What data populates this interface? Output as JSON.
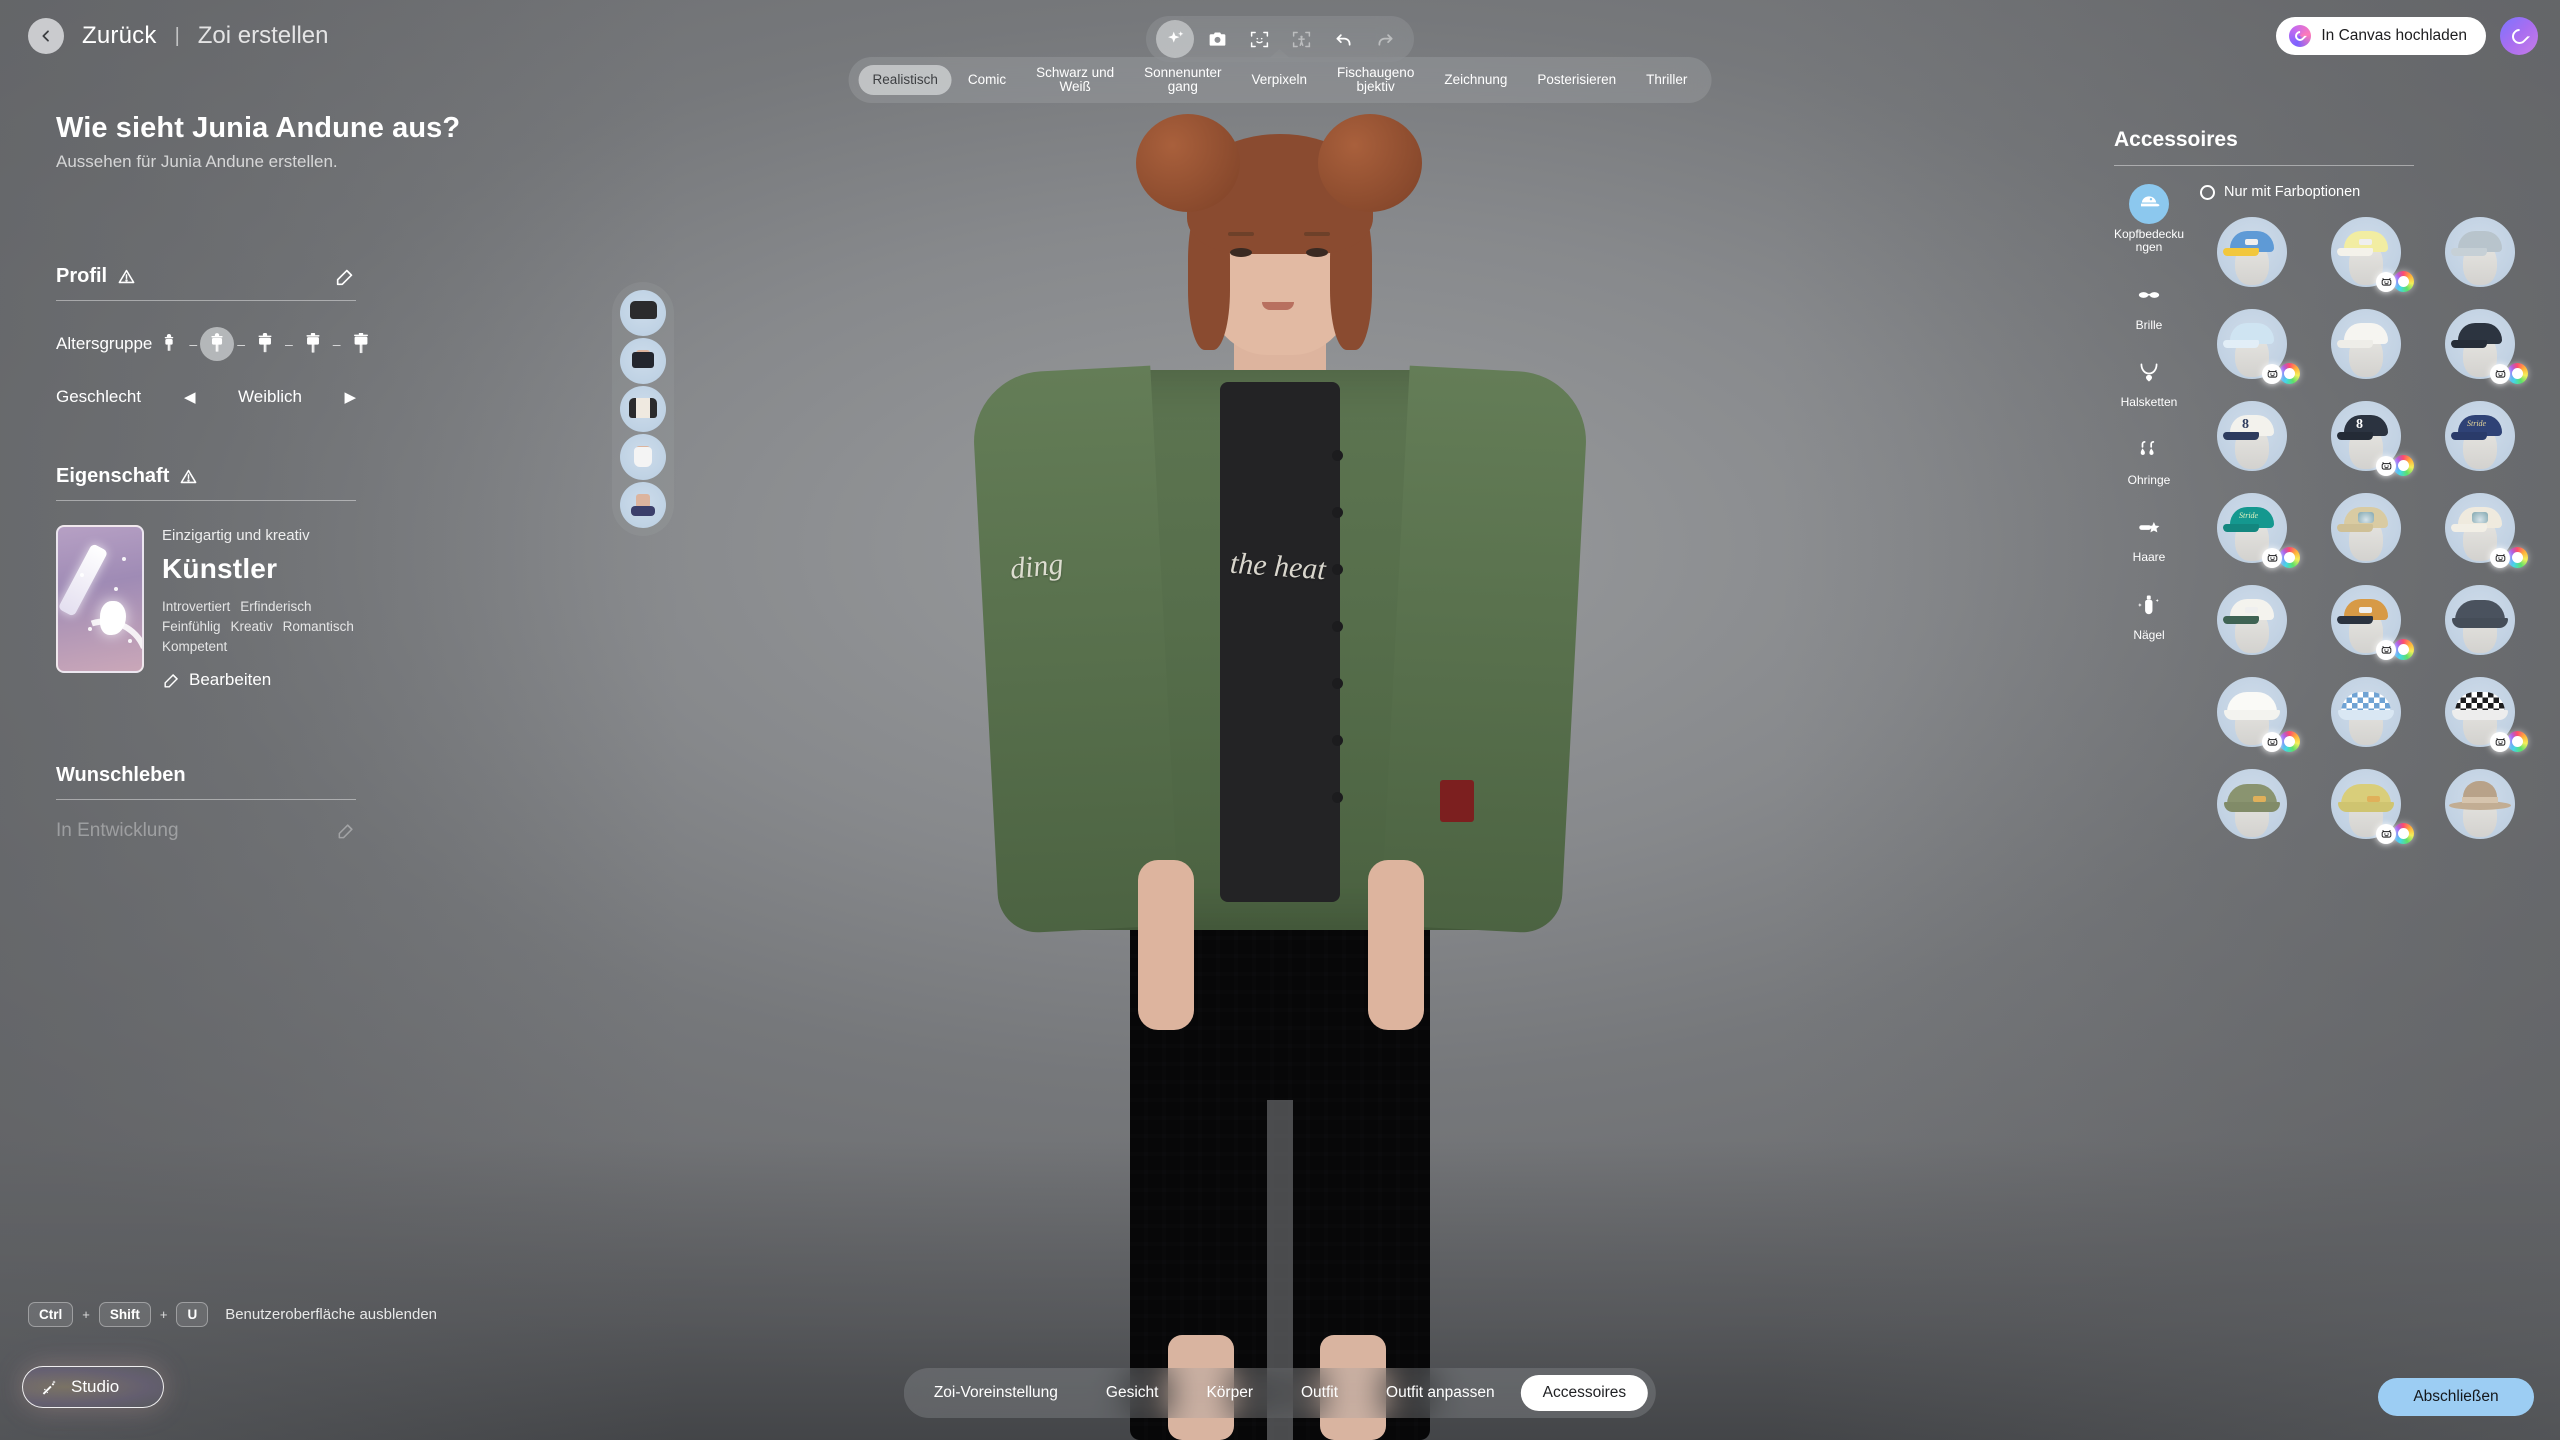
{
  "header": {
    "back_label": "Zurück",
    "separator": "|",
    "current_label": "Zoi erstellen",
    "title": "Wie sieht Junia Andune aus?",
    "subtitle": "Aussehen für Junia Andune erstellen."
  },
  "top_right": {
    "canvas_button": "In Canvas hochladen"
  },
  "toolbar": {
    "items": [
      {
        "name": "sparkle-icon",
        "selected": true,
        "dimmed": false
      },
      {
        "name": "camera-icon",
        "selected": false,
        "dimmed": false
      },
      {
        "name": "face-frame-icon",
        "selected": false,
        "dimmed": false
      },
      {
        "name": "body-frame-icon",
        "selected": false,
        "dimmed": true
      },
      {
        "name": "undo-icon",
        "selected": false,
        "dimmed": false
      },
      {
        "name": "redo-icon",
        "selected": false,
        "dimmed": true
      }
    ]
  },
  "style_tabs": {
    "selected": "Realistisch",
    "items": [
      "Realistisch",
      "Comic",
      "Schwarz und\nWeiß",
      "Sonnenunter\ngang",
      "Verpixeln",
      "Fischaugeno\nbjektiv",
      "Zeichnung",
      "Posterisieren",
      "Thriller"
    ]
  },
  "left_panel": {
    "profile": {
      "title": "Profil",
      "warning_icon": "warning-triangle-icon",
      "edit_icon": "edit-pencil-icon",
      "age_row_label": "Altersgruppe",
      "age_options": [
        "child",
        "teen",
        "young-adult",
        "adult",
        "senior"
      ],
      "age_selected_index": 1,
      "gender_row_label": "Geschlecht",
      "gender_value": "Weiblich",
      "gender_prev_icon": "chevron-left-icon",
      "gender_next_icon": "chevron-right-icon"
    },
    "trait": {
      "title": "Eigenschaft",
      "warning_icon": "warning-triangle-icon",
      "subtitle": "Einzigartig und kreativ",
      "name": "Künstler",
      "tags": [
        "Introvertiert",
        "Erfinderisch",
        "Feinfühlig",
        "Kreativ",
        "Romantisch",
        "Kompetent"
      ],
      "edit_label": "Bearbeiten",
      "card_art": "paintbrush-tarot-card"
    },
    "dream_life": {
      "title": "Wunschleben",
      "placeholder": "In Entwicklung",
      "edit_icon": "edit-pencil-icon"
    }
  },
  "shortcut": {
    "keys": [
      "Ctrl",
      "Shift",
      "U"
    ],
    "plus": "+",
    "label": "Benutzeroberfläche ausblenden"
  },
  "studio_button": {
    "label": "Studio",
    "icon": "magic-wand-icon"
  },
  "outfit_strip": {
    "items": [
      "shirt",
      "shorts",
      "jacket",
      "socks",
      "shoes"
    ]
  },
  "right_panel": {
    "title": "Accessoires",
    "filter": {
      "label": "Nur mit Farboptionen",
      "checked": false
    },
    "categories": [
      {
        "label": "Kopfbedecku\nngen",
        "icon": "cap-icon",
        "selected": true
      },
      {
        "label": "Brille",
        "icon": "glasses-icon",
        "selected": false
      },
      {
        "label": "Halsketten",
        "icon": "necklace-icon",
        "selected": false
      },
      {
        "label": "Ohringe",
        "icon": "earrings-icon",
        "selected": false
      },
      {
        "label": "Haare",
        "icon": "hairclip-icon",
        "selected": false
      },
      {
        "label": "Nägel",
        "icon": "nail-polish-icon",
        "selected": false
      }
    ],
    "items": [
      {
        "type": "cap",
        "crown": "#5e9ad6",
        "brim": "#f2c73c",
        "patch": true,
        "badges": false
      },
      {
        "type": "cap",
        "crown": "#f2eda2",
        "brim": "#f4f2ea",
        "patch": true,
        "badges": true
      },
      {
        "type": "cap",
        "crown": "#b8c4cc",
        "brim": "#c6d0d6",
        "patch": false,
        "badges": false
      },
      {
        "type": "cap",
        "crown": "#cfe4f2",
        "brim": "#e2eef7",
        "patch": false,
        "badges": true
      },
      {
        "type": "cap",
        "crown": "#f6f5f1",
        "brim": "#eeede8",
        "patch": false,
        "badges": false
      },
      {
        "type": "cap",
        "crown": "#2c3440",
        "brim": "#262d38",
        "patch": false,
        "badges": true
      },
      {
        "type": "cap",
        "crown": "#f3f2ed",
        "brim": "#2d3b5e",
        "num": "8",
        "numcolor": "#2d3b5e",
        "badges": false
      },
      {
        "type": "cap",
        "crown": "#2b3340",
        "brim": "#242b36",
        "num": "8",
        "numcolor": "#ffffff",
        "badges": true
      },
      {
        "type": "cap",
        "crown": "#2f4276",
        "brim": "#2a3b6a",
        "script": "Stride",
        "scriptcolor": "#e8d79a",
        "badges": false
      },
      {
        "type": "cap",
        "crown": "#14988f",
        "brim": "#13877f",
        "script": "Stride",
        "scriptcolor": "#dff3c0",
        "badges": true
      },
      {
        "type": "cap",
        "crown": "#d9cba2",
        "brim": "#cfc096",
        "mtn": true,
        "badges": false
      },
      {
        "type": "cap",
        "crown": "#efeade",
        "brim": "#f2efe6",
        "mtn": true,
        "badges": true
      },
      {
        "type": "cap",
        "crown": "#f4f3ee",
        "brim": "#3f6354",
        "patch": true,
        "badges": false
      },
      {
        "type": "cap",
        "crown": "#d79a46",
        "brim": "#2b3340",
        "patch": true,
        "badges": true
      },
      {
        "type": "bucket",
        "crown": "#4a525e",
        "brim": "#454d58",
        "badges": false
      },
      {
        "type": "bucket",
        "crown": "#fafaf7",
        "brim": "#f3f3ef",
        "badges": true
      },
      {
        "type": "bucket",
        "crown": "checker-blue",
        "brim": "#d9e7f3",
        "badges": false
      },
      {
        "type": "bucket",
        "crown": "checker-black",
        "brim": "#ededed",
        "badges": true
      },
      {
        "type": "bucket",
        "crown": "#8a9470",
        "brim": "#818b68",
        "patch": true,
        "badges": false
      },
      {
        "type": "bucket",
        "crown": "#d9ce7a",
        "brim": "#cfc470",
        "patch": true,
        "badges": true
      },
      {
        "type": "fedora",
        "crown": "#b8a289",
        "brim": "#c2ad93",
        "badges": false
      }
    ]
  },
  "bottom_nav": {
    "selected": "Accessoires",
    "items": [
      "Zoi-Voreinstellung",
      "Gesicht",
      "Körper",
      "Outfit",
      "Outfit anpassen",
      "Accessoires"
    ]
  },
  "finish_button": {
    "label": "Abschließen"
  },
  "avatar_scene": {
    "jacket_text_left": "ding",
    "jacket_text_right": "the heat"
  }
}
